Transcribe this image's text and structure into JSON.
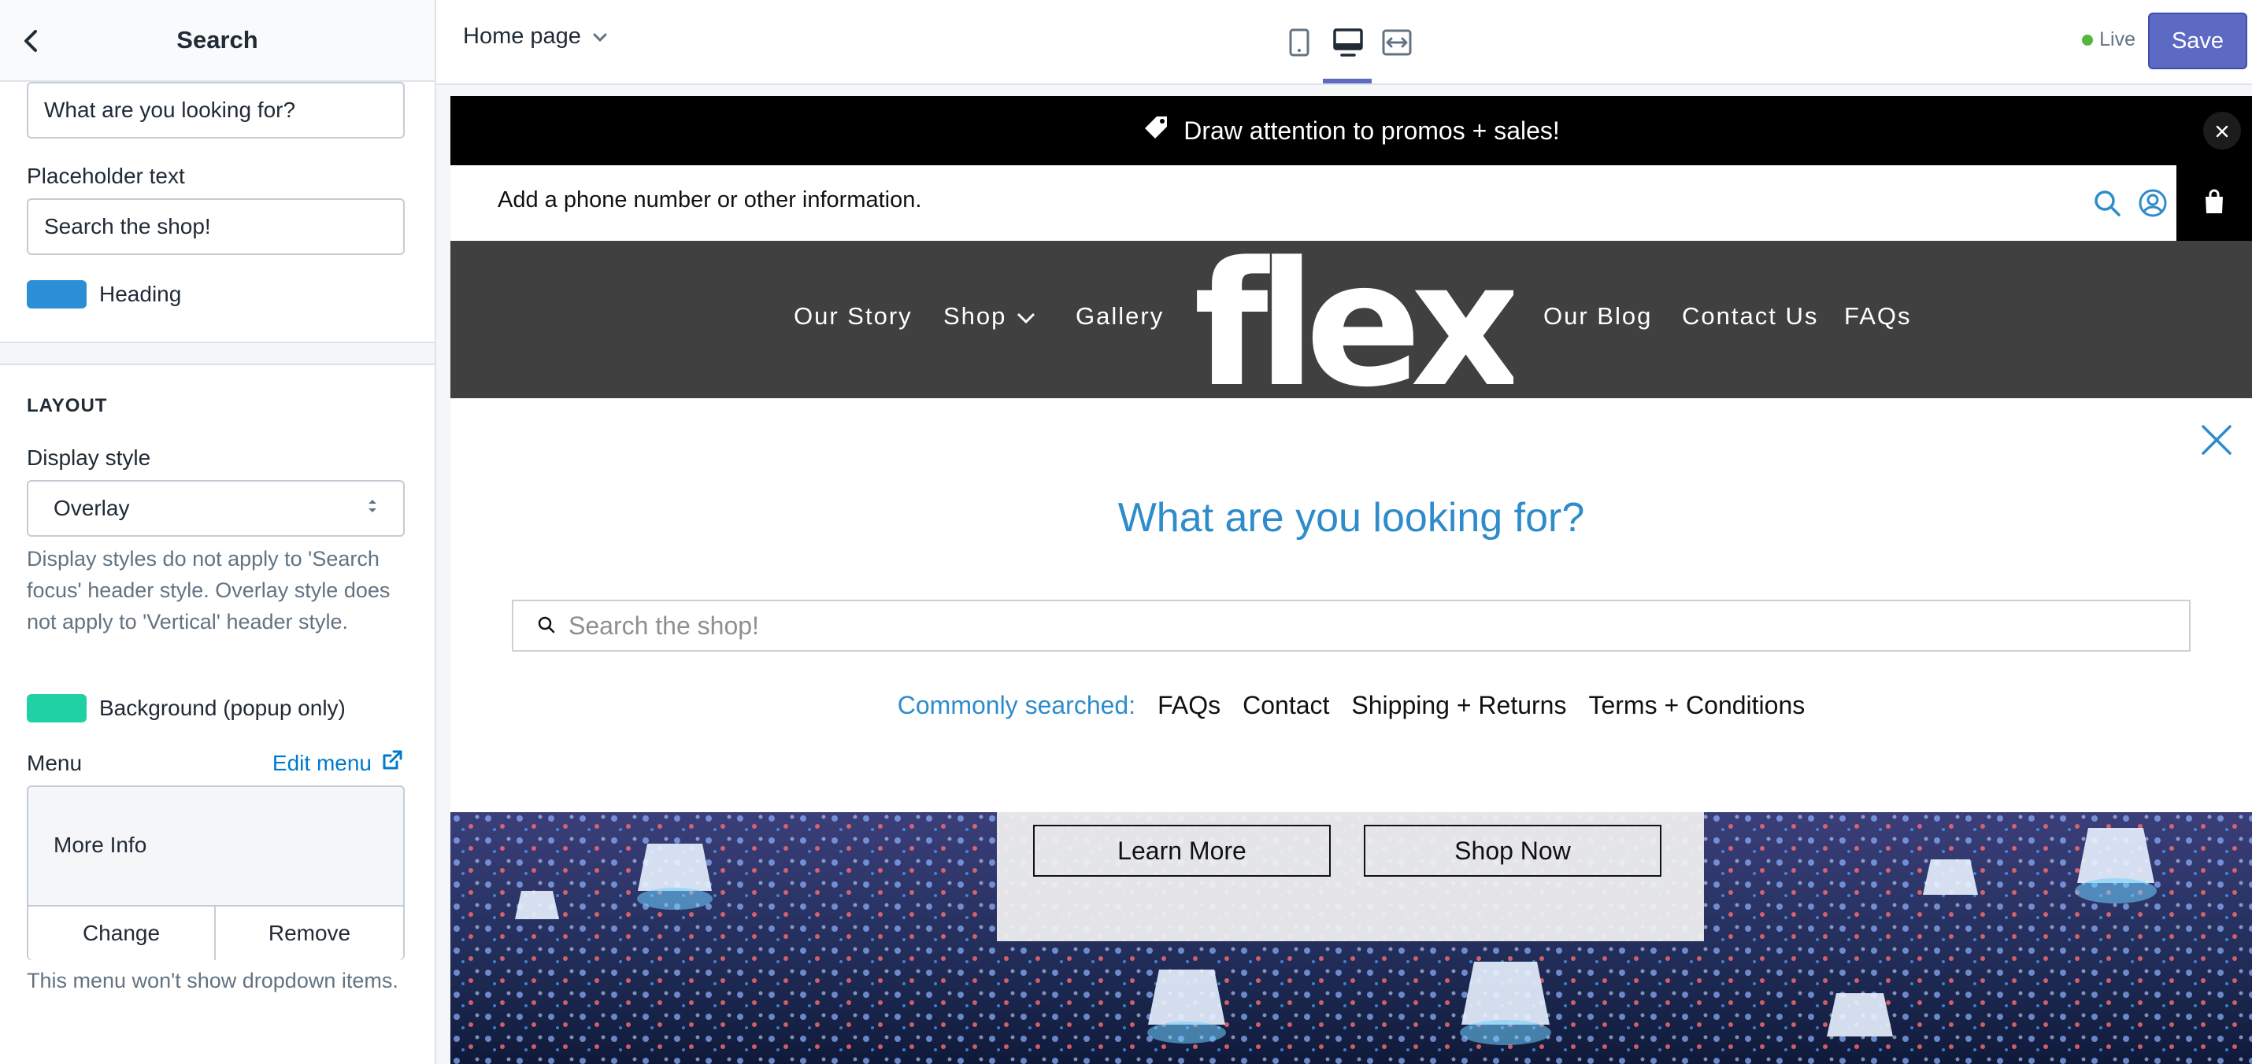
{
  "sidebar": {
    "title": "Search",
    "heading_value": "What are you looking for?",
    "placeholder_label": "Placeholder text",
    "placeholder_value": "Search the shop!",
    "heading_color_label": "Heading",
    "heading_color": "#2c8fd6",
    "layout_title": "LAYOUT",
    "display_style_label": "Display style",
    "display_style_value": "Overlay",
    "display_help": "Display styles do not apply to 'Search focus' header style. Overlay style does not apply to 'Vertical' header style.",
    "background_label": "Background (popup only)",
    "background_color": "#1fd1a5",
    "menu_label": "Menu",
    "edit_menu_label": "Edit menu",
    "menu_name": "More Info",
    "change_label": "Change",
    "remove_label": "Remove",
    "menu_help": "This menu won't show dropdown items."
  },
  "topbar": {
    "page_select": "Home page",
    "devices": [
      "mobile-icon",
      "desktop-icon",
      "fullscreen-icon"
    ],
    "active_device": "desktop",
    "live_label": "Live",
    "save_label": "Save",
    "accent_color": "#5c6ac4"
  },
  "preview": {
    "promo_text": "Draw attention to promos + sales!",
    "info_text": "Add a phone number or other information.",
    "nav_left": [
      "Our Story",
      "Shop",
      "Gallery"
    ],
    "logo_text": "flex",
    "nav_right": [
      "Our Blog",
      "Contact Us",
      "FAQs"
    ],
    "search_heading": "What are you looking for?",
    "search_placeholder": "Search the shop!",
    "common_label": "Commonly searched:",
    "common_links": [
      "FAQs",
      "Contact",
      "Shipping + Returns",
      "Terms + Conditions"
    ],
    "hero_buttons": [
      "Learn More",
      "Shop Now"
    ]
  }
}
